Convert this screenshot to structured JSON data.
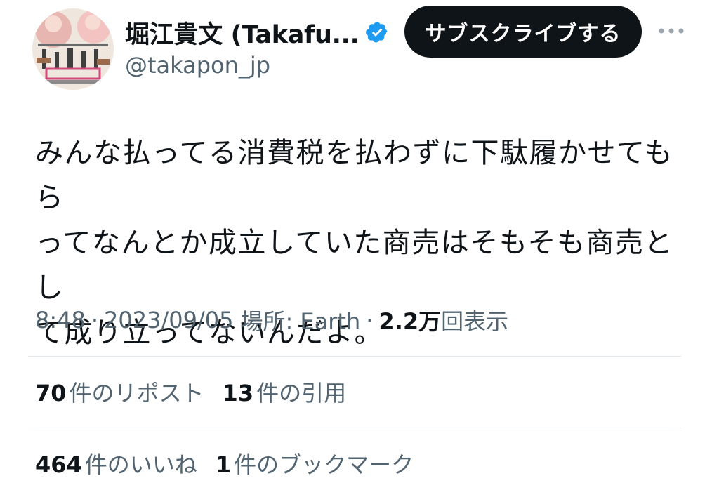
{
  "author": {
    "display_name": "堀江貴文 (Takafu...",
    "handle": "@takapon_jp",
    "verified_color": "#1d9bf0"
  },
  "actions": {
    "subscribe_label": "サブスクライブする",
    "more_icon": "more-horizontal-icon"
  },
  "tweet": {
    "text": "みんな払ってる消費税を払わずに下駄履かせてもら\nってなんとか成立していた商売はそもそも商売とし\nて成り立ってないんだよ。"
  },
  "meta": {
    "time": "8:48",
    "date": "2023/09/05",
    "location_label": "場所: Earth",
    "views_count": "2.2万",
    "views_label": "回表示",
    "separator": "·"
  },
  "stats": {
    "reposts": {
      "count": "70",
      "label": "件のリポスト"
    },
    "quotes": {
      "count": "13",
      "label": "件の引用"
    },
    "likes": {
      "count": "464",
      "label": "件のいいね"
    },
    "bookmarks": {
      "count": "1",
      "label": "件のブックマーク"
    }
  },
  "colors": {
    "text_primary": "#0f1419",
    "text_secondary": "#536471",
    "button_bg": "#0f1419",
    "divider": "#e1e6ea"
  }
}
